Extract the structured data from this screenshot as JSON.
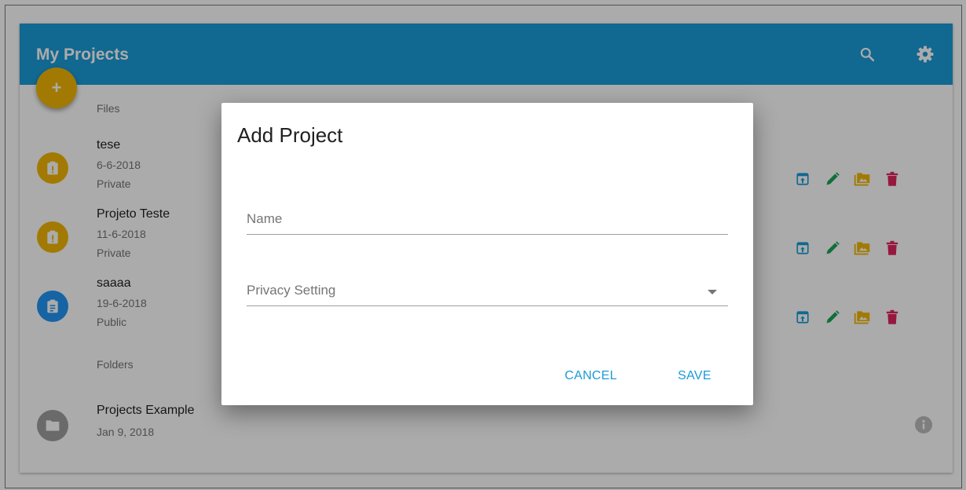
{
  "appbar": {
    "title": "My Projects",
    "search_icon": "search-icon",
    "settings_icon": "gear-icon",
    "color": "#1a9bd7"
  },
  "fab": {
    "label": "+",
    "color": "#f2b705"
  },
  "sections": {
    "files": "Files",
    "folders": "Folders"
  },
  "files": [
    {
      "name": "tese",
      "date": "6-6-2018",
      "privacy": "Private",
      "avatar_color": "#f2b705",
      "icon": "clipboard-alert-icon"
    },
    {
      "name": "Projeto Teste",
      "date": "11-6-2018",
      "privacy": "Private",
      "avatar_color": "#f2b705",
      "icon": "clipboard-alert-icon"
    },
    {
      "name": "saaaa",
      "date": "19-6-2018",
      "privacy": "Public",
      "avatar_color": "#2196f3",
      "icon": "clipboard-text-icon"
    }
  ],
  "file_actions": [
    {
      "icon": "open-in-app-icon",
      "color": "#1a9bd7"
    },
    {
      "icon": "pencil-icon",
      "color": "#1aa55a"
    },
    {
      "icon": "image-folder-icon",
      "color": "#f2b705"
    },
    {
      "icon": "trash-icon",
      "color": "#e0245e"
    }
  ],
  "folders": [
    {
      "name": "Projects Example",
      "date": "Jan 9, 2018",
      "icon": "folder-icon",
      "info_icon": "info-icon"
    }
  ],
  "dialog": {
    "title": "Add Project",
    "name_placeholder": "Name",
    "privacy_placeholder": "Privacy Setting",
    "cancel_label": "CANCEL",
    "save_label": "SAVE",
    "button_color": "#1a9bd7"
  }
}
